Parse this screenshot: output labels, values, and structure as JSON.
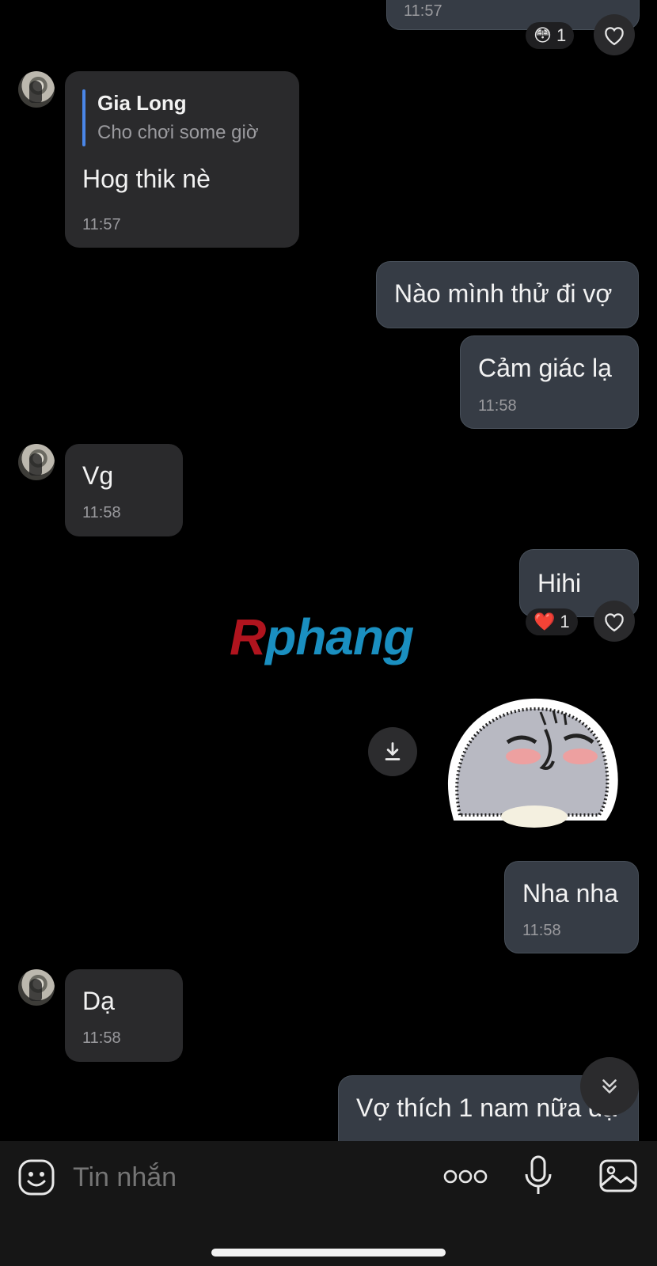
{
  "messages": {
    "top_out": {
      "time": "11:57",
      "reaction_emoji": "😳",
      "reaction_count": "1"
    },
    "m1": {
      "quote_name": "Gia Long",
      "quote_text": "Cho chơi some giờ",
      "text": "Hog thik nè",
      "time": "11:57"
    },
    "m2": {
      "text": "Nào mình thử đi vợ"
    },
    "m3": {
      "text": "Cảm giác lạ",
      "time": "11:58"
    },
    "m4": {
      "text": "Vg",
      "time": "11:58"
    },
    "m5": {
      "text": "Hihi",
      "reaction_emoji": "❤️",
      "reaction_count": "1"
    },
    "m6": {
      "sticker": "sticker-blushing-bear"
    },
    "m7": {
      "text": "Nha nha",
      "time": "11:58"
    },
    "m8": {
      "text": "Dạ",
      "time": "11:58"
    },
    "m9": {
      "text": "Vợ thích 1 nam nữa dạ"
    }
  },
  "watermark": {
    "first": "R",
    "rest": "phang"
  },
  "composer": {
    "placeholder": "Tin nhắn",
    "more_label": "ooo"
  },
  "icons": [
    "emoji-icon",
    "more-icon",
    "mic-icon",
    "image-icon",
    "heart-icon",
    "download-icon",
    "chevron-double-down-icon"
  ],
  "colors": {
    "incoming_bubble": "#2a2a2c",
    "outgoing_bubble": "#363c45",
    "quote_bar": "#4a86e8",
    "background": "#000000"
  }
}
